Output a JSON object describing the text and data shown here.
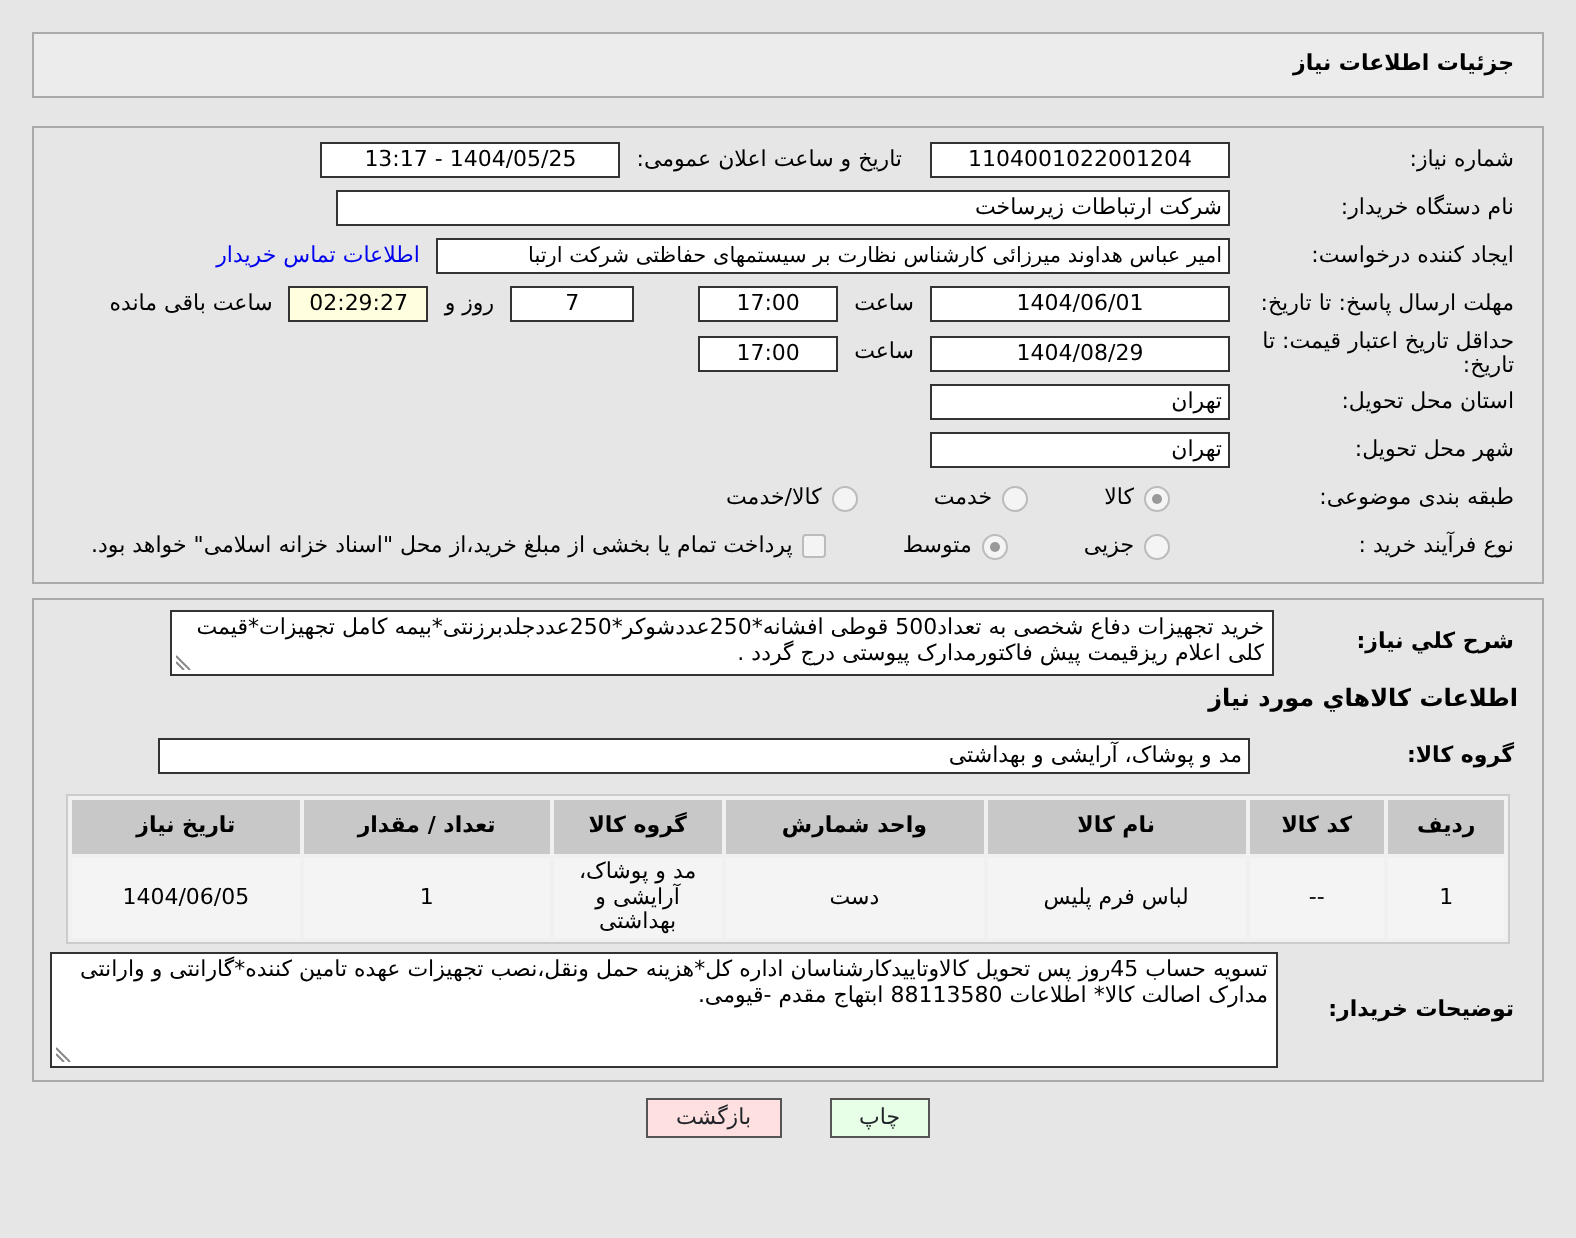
{
  "title": "جزئیات اطلاعات نیاز",
  "need_number": {
    "label": "شماره نیاز:",
    "value": "1104001022001204"
  },
  "announce": {
    "label": "تاریخ و ساعت اعلان عمومی:",
    "value": "1404/05/25 - 13:17"
  },
  "buyer_org": {
    "label": "نام دستگاه خریدار:",
    "value": "شرکت ارتباطات زیرساخت"
  },
  "requester": {
    "label": "ایجاد کننده درخواست:",
    "value": "امیر عباس هداوند میرزائی کارشناس نظارت بر سیستمهای حفاظتی شرکت ارتبا",
    "link": "اطلاعات تماس خریدار"
  },
  "response_deadline": {
    "label": "مهلت ارسال پاسخ: تا تاریخ:",
    "date": "1404/06/01",
    "time_label": "ساعت",
    "time": "17:00",
    "days": "7",
    "days_label": "روز و",
    "remaining": "02:29:27",
    "remaining_label": "ساعت باقی مانده"
  },
  "price_validity": {
    "label": "حداقل تاریخ اعتبار قیمت: تا تاریخ:",
    "date": "1404/08/29",
    "time_label": "ساعت",
    "time": "17:00"
  },
  "province": {
    "label": "استان محل تحویل:",
    "value": "تهران"
  },
  "city": {
    "label": "شهر محل تحویل:",
    "value": "تهران"
  },
  "category": {
    "label": "طبقه بندی موضوعی:",
    "options": [
      {
        "label": "کالا",
        "selected": true
      },
      {
        "label": "خدمت",
        "selected": false
      },
      {
        "label": "کالا/خدمت",
        "selected": false
      }
    ]
  },
  "process": {
    "label": "نوع فرآیند خرید :",
    "options": [
      {
        "label": "جزیی",
        "selected": false
      },
      {
        "label": "متوسط",
        "selected": true
      }
    ],
    "payment": {
      "label": "پرداخت تمام یا بخشی از مبلغ خرید،از محل \"اسناد خزانه اسلامی\" خواهد بود.",
      "checked": false
    }
  },
  "description": {
    "label": "شرح کلي نياز:",
    "value": "خرید تجهیزات دفاع شخصی به تعداد500 قوطی افشانه*250عددشوکر*250عددجلدبرزنتی*بیمه کامل تجهیزات*قیمت کلی اعلام ریزقیمت پیش فاکتورمدارک پیوستی درج گردد ."
  },
  "goods_title": "اطلاعات کالاهاي مورد نياز",
  "goods_group": {
    "label": "گروه کالا:",
    "value": "مد و پوشاک، آرایشی و بهداشتی"
  },
  "table": {
    "columns": [
      "ردیف",
      "کد کالا",
      "نام کالا",
      "واحد شمارش",
      "گروه کالا",
      "تعداد / مقدار",
      "تاریخ نیاز"
    ],
    "rows": [
      [
        "1",
        "--",
        "لباس فرم پلیس",
        "دست",
        "مد و پوشاک، آرایشی و بهداشتی",
        "1",
        "1404/06/05"
      ]
    ]
  },
  "buyer_notes": {
    "label": "توضیحات خریدار:",
    "value": "تسویه حساب 45روز پس تحویل کالاوتاییدکارشناسان  اداره کل*هزینه حمل ونقل،نصب تجهیزات عهده تامین کننده*گارانتی و وارانتی مدارک اصالت کالا* اطلاعات 88113580 ابتهاج مقدم -قیومی."
  },
  "buttons": [
    {
      "label": "چاپ",
      "kind": "print"
    },
    {
      "label": "بازگشت",
      "kind": "back"
    }
  ]
}
